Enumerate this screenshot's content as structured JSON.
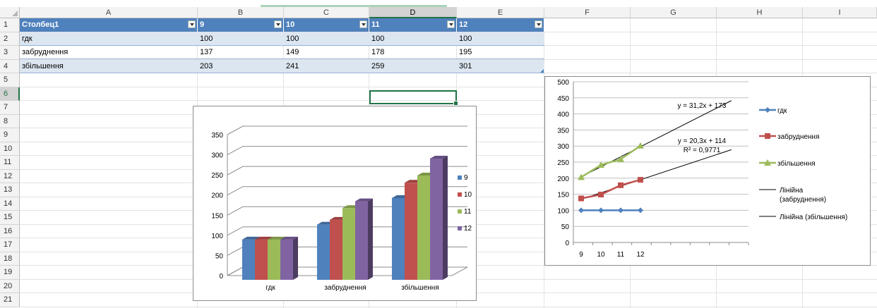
{
  "columns": [
    "A",
    "B",
    "C",
    "D",
    "E",
    "F",
    "G",
    "H",
    "I"
  ],
  "rows": [
    "1",
    "2",
    "3",
    "4",
    "5",
    "6",
    "7",
    "8",
    "9",
    "10",
    "11",
    "12",
    "13",
    "14",
    "15",
    "16",
    "17",
    "18",
    "19",
    "20",
    "21"
  ],
  "table": {
    "headers": [
      "Столбец1",
      "9",
      "10",
      "11",
      "12"
    ],
    "rows": [
      [
        "гдк",
        "100",
        "100",
        "100",
        "100"
      ],
      [
        "забруднення",
        "137",
        "149",
        "178",
        "195"
      ],
      [
        "збільшення",
        "203",
        "241",
        "259",
        "301"
      ]
    ]
  },
  "chart_data": [
    {
      "type": "bar",
      "categories": [
        "гдк",
        "забруднення",
        "збільшення"
      ],
      "series": [
        {
          "name": "9",
          "values": [
            100,
            137,
            203
          ],
          "color": "#4f81bd"
        },
        {
          "name": "10",
          "values": [
            100,
            149,
            241
          ],
          "color": "#c0504d"
        },
        {
          "name": "11",
          "values": [
            100,
            178,
            259
          ],
          "color": "#9bbb59"
        },
        {
          "name": "12",
          "values": [
            100,
            195,
            301
          ],
          "color": "#8064a2"
        }
      ],
      "yticks": [
        "0",
        "50",
        "100",
        "150",
        "200",
        "250",
        "300",
        "350"
      ],
      "ylim": [
        0,
        350
      ],
      "grid": true,
      "legend": "right"
    },
    {
      "type": "line",
      "x": [
        "9",
        "10",
        "11",
        "12"
      ],
      "series": [
        {
          "name": "гдк",
          "values": [
            100,
            100,
            100,
            100
          ],
          "color": "#4f81bd",
          "marker": "diamond"
        },
        {
          "name": "забруднення",
          "values": [
            137,
            149,
            178,
            195
          ],
          "color": "#c0504d",
          "marker": "square"
        },
        {
          "name": "збільшення",
          "values": [
            203,
            241,
            259,
            301
          ],
          "color": "#9bbb59",
          "marker": "triangle"
        }
      ],
      "trendlines": [
        {
          "name": "Лінійна (забруднення)",
          "name_lines": [
            "Лінійна",
            "(забруднення)"
          ],
          "equation": "y = 20,3x + 114",
          "r2": "R² = 0,9771"
        },
        {
          "name": "Лінійна (збільшення)",
          "name_lines": [
            "Лінійна (збільшення)"
          ],
          "equation": "y = 31,2x + 173"
        }
      ],
      "yticks": [
        "0",
        "50",
        "100",
        "150",
        "200",
        "250",
        "300",
        "350",
        "400",
        "450",
        "500"
      ],
      "ylim": [
        0,
        500
      ],
      "grid": true,
      "legend": "right"
    }
  ]
}
